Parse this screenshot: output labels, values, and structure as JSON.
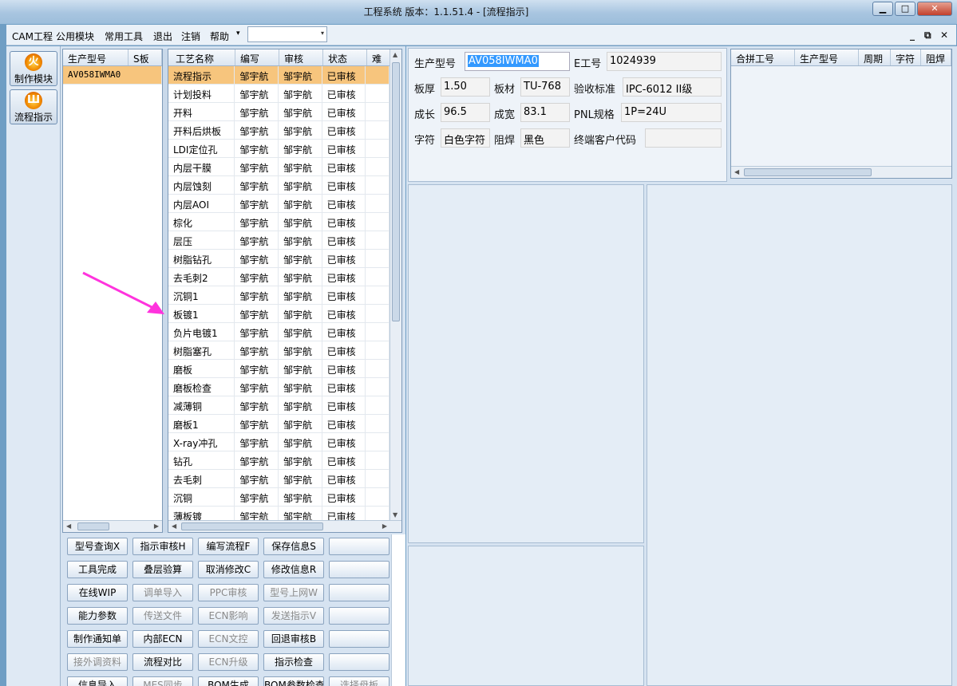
{
  "window": {
    "title": "工程系统   版本：1.1.51.4 - [流程指示]",
    "min_glyph": "▁",
    "max_glyph": "□",
    "close_glyph": "✕"
  },
  "menubar": {
    "items": [
      "CAM工程",
      "公用模块",
      "常用工具",
      "退出",
      "注销",
      "帮助"
    ],
    "dropdown_glyph": "▾",
    "combo_value": "",
    "mdi_min": "_",
    "mdi_restore": "⧉",
    "mdi_close": "✕"
  },
  "leftbar": {
    "buttons": [
      {
        "label": "制作模块",
        "icon": "flame-icon",
        "glyph": "火"
      },
      {
        "label": "流程指示",
        "icon": "flow-icon",
        "glyph": "Ш"
      }
    ]
  },
  "model_grid": {
    "headers": [
      "生产型号",
      "S板"
    ],
    "rows": [
      [
        "AV058IWMA0",
        ""
      ]
    ]
  },
  "process_grid": {
    "headers": [
      "工艺名称",
      "编写",
      "审核",
      "状态",
      "难"
    ],
    "rows": [
      [
        "流程指示",
        "邹宇航",
        "邹宇航",
        "已审核"
      ],
      [
        "计划投料",
        "邹宇航",
        "邹宇航",
        "已审核"
      ],
      [
        "开料",
        "邹宇航",
        "邹宇航",
        "已审核"
      ],
      [
        "开料后烘板",
        "邹宇航",
        "邹宇航",
        "已审核"
      ],
      [
        "LDI定位孔",
        "邹宇航",
        "邹宇航",
        "已审核"
      ],
      [
        "内层干膜",
        "邹宇航",
        "邹宇航",
        "已审核"
      ],
      [
        "内层蚀刻",
        "邹宇航",
        "邹宇航",
        "已审核"
      ],
      [
        "内层AOI",
        "邹宇航",
        "邹宇航",
        "已审核"
      ],
      [
        "棕化",
        "邹宇航",
        "邹宇航",
        "已审核"
      ],
      [
        "层压",
        "邹宇航",
        "邹宇航",
        "已审核"
      ],
      [
        "树脂钻孔",
        "邹宇航",
        "邹宇航",
        "已审核"
      ],
      [
        "去毛刺2",
        "邹宇航",
        "邹宇航",
        "已审核"
      ],
      [
        "沉铜1",
        "邹宇航",
        "邹宇航",
        "已审核"
      ],
      [
        "板镀1",
        "邹宇航",
        "邹宇航",
        "已审核"
      ],
      [
        "负片电镀1",
        "邹宇航",
        "邹宇航",
        "已审核"
      ],
      [
        "树脂塞孔",
        "邹宇航",
        "邹宇航",
        "已审核"
      ],
      [
        "磨板",
        "邹宇航",
        "邹宇航",
        "已审核"
      ],
      [
        "磨板检查",
        "邹宇航",
        "邹宇航",
        "已审核"
      ],
      [
        "减薄铜",
        "邹宇航",
        "邹宇航",
        "已审核"
      ],
      [
        "磨板1",
        "邹宇航",
        "邹宇航",
        "已审核"
      ],
      [
        "X-ray冲孔",
        "邹宇航",
        "邹宇航",
        "已审核"
      ],
      [
        "钻孔",
        "邹宇航",
        "邹宇航",
        "已审核"
      ],
      [
        "去毛刺",
        "邹宇航",
        "邹宇航",
        "已审核"
      ],
      [
        "沉铜",
        "邹宇航",
        "邹宇航",
        "已审核"
      ],
      [
        "薄板镀",
        "邹宇航",
        "邹宇航",
        "已审核"
      ]
    ]
  },
  "buttons": [
    [
      {
        "label": "型号查询X",
        "enabled": true
      },
      {
        "label": "指示审核H",
        "enabled": true
      },
      {
        "label": "编写流程F",
        "enabled": true
      },
      {
        "label": "保存信息S",
        "enabled": true
      },
      {
        "label": "",
        "enabled": true
      }
    ],
    [
      {
        "label": "工具完成",
        "enabled": true
      },
      {
        "label": "叠层验算",
        "enabled": true
      },
      {
        "label": "取消修改C",
        "enabled": true
      },
      {
        "label": "修改信息R",
        "enabled": true
      },
      {
        "label": "",
        "enabled": true
      }
    ],
    [
      {
        "label": "在线WIP",
        "enabled": true
      },
      {
        "label": "调单导入",
        "enabled": false
      },
      {
        "label": "PPC审核",
        "enabled": false
      },
      {
        "label": "型号上网W",
        "enabled": false
      },
      {
        "label": "",
        "enabled": true
      }
    ],
    [
      {
        "label": "能力参数",
        "enabled": true
      },
      {
        "label": "传送文件",
        "enabled": false
      },
      {
        "label": "ECN影响",
        "enabled": false
      },
      {
        "label": "发送指示V",
        "enabled": false
      },
      {
        "label": "",
        "enabled": true
      }
    ],
    [
      {
        "label": "制作通知单",
        "enabled": true
      },
      {
        "label": "内部ECN",
        "enabled": true
      },
      {
        "label": "ECN文控",
        "enabled": false
      },
      {
        "label": "回退审核B",
        "enabled": true
      },
      {
        "label": "",
        "enabled": true
      }
    ],
    [
      {
        "label": "接外调资料",
        "enabled": false
      },
      {
        "label": "流程对比",
        "enabled": true
      },
      {
        "label": "ECN升级",
        "enabled": false
      },
      {
        "label": "指示检查",
        "enabled": true
      },
      {
        "label": "",
        "enabled": true
      }
    ],
    [
      {
        "label": "信息导入",
        "enabled": true
      },
      {
        "label": "MES同步",
        "enabled": false
      },
      {
        "label": "BOM生成",
        "enabled": true
      },
      {
        "label": "BOM参数检查",
        "enabled": true
      },
      {
        "label": "选择母板",
        "enabled": false
      }
    ]
  ],
  "info": {
    "model_label": "生产型号",
    "model_value": "AV058IWMA0",
    "e_label": "E工号",
    "e_value": "1024939",
    "thick_label": "板厚",
    "thick_value": "1.50",
    "material_label": "板材",
    "material_value": "TU-768",
    "std_label": "验收标准",
    "std_value": "IPC-6012 II级",
    "len_label": "成长",
    "len_value": "96.5",
    "wid_label": "成宽",
    "wid_value": "83.1",
    "pnl_label": "PNL规格",
    "pnl_value": "1P=24U",
    "char_label": "字符",
    "char_value": "白色字符",
    "mask_label": "阻焊",
    "mask_value": "黑色",
    "cust_label": "终端客户代码",
    "cust_value": ""
  },
  "merge_grid": {
    "headers": [
      "合拼工号",
      "生产型号",
      "周期",
      "字符",
      "阻焊"
    ]
  },
  "colors": {
    "accent": "#ff33dd",
    "selected_row": "#f7c57d"
  }
}
